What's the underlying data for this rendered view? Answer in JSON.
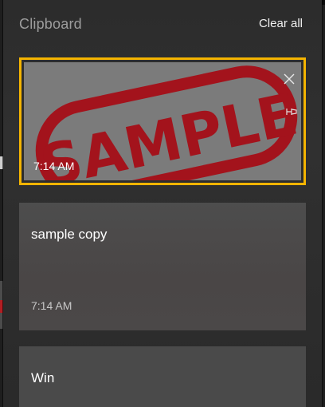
{
  "header": {
    "title": "Clipboard",
    "clear_all": "Clear all"
  },
  "items": [
    {
      "type": "image",
      "image_text": "SAMPLE",
      "time": "7:14 AM",
      "selected": true
    },
    {
      "type": "text",
      "text": "sample copy",
      "time": "7:14 AM"
    },
    {
      "type": "text",
      "text": "Win"
    }
  ],
  "colors": {
    "accent": "#f5b400",
    "stamp": "#a3131c"
  },
  "icons": {
    "close": "close-icon",
    "pin": "pin-icon"
  }
}
